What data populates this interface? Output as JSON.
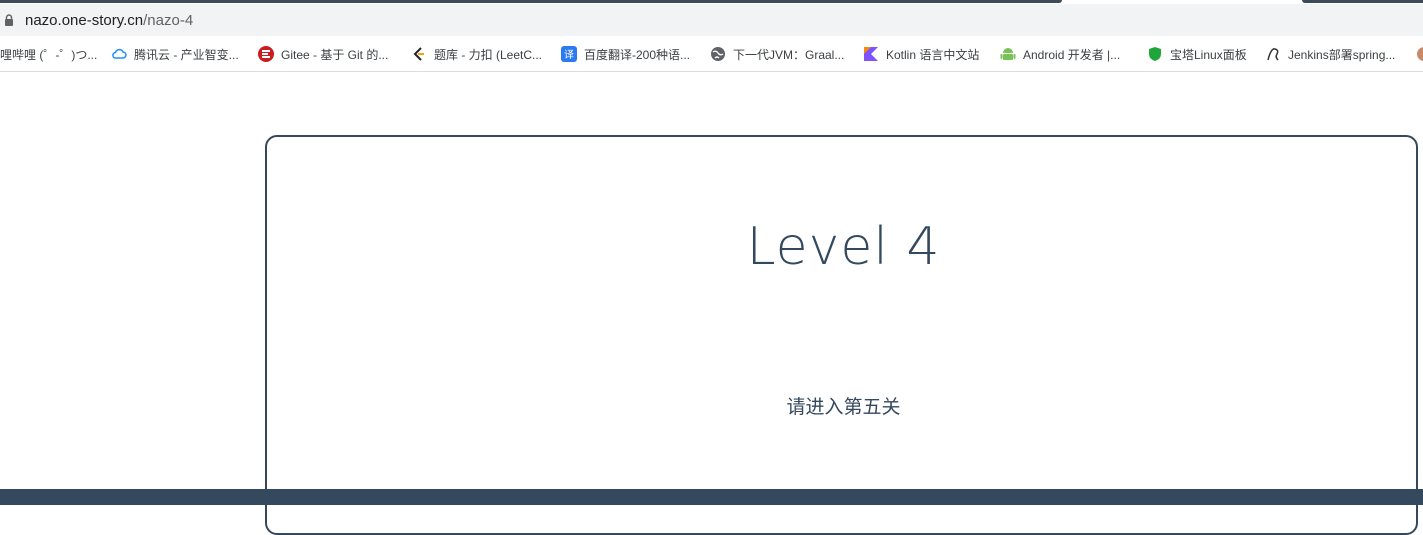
{
  "browser": {
    "url_host": "nazo.one-story.cn",
    "url_path": "/nazo-4"
  },
  "bookmarks": [
    {
      "label": "哩哔哩 (゜-゜)つ...",
      "icon": "bilibili-icon"
    },
    {
      "label": "腾讯云 - 产业智变...",
      "icon": "tencent-cloud-icon"
    },
    {
      "label": "Gitee - 基于 Git 的...",
      "icon": "gitee-icon"
    },
    {
      "label": "题库 - 力扣 (LeetC...",
      "icon": "leetcode-icon"
    },
    {
      "label": "百度翻译-200种语...",
      "icon": "baidu-translate-icon"
    },
    {
      "label": "下一代JVM：Graal...",
      "icon": "globe-icon"
    },
    {
      "label": "Kotlin 语言中文站",
      "icon": "kotlin-icon"
    },
    {
      "label": "Android 开发者 |...",
      "icon": "android-icon"
    },
    {
      "label": "宝塔Linux面板",
      "icon": "baota-icon"
    },
    {
      "label": "Jenkins部署spring...",
      "icon": "jenkins-icon"
    }
  ],
  "page": {
    "title": "Level 4",
    "hint": "请进入第五关"
  },
  "colors": {
    "primary": "#34495e",
    "toolbar_bg": "#f1f3f4"
  }
}
